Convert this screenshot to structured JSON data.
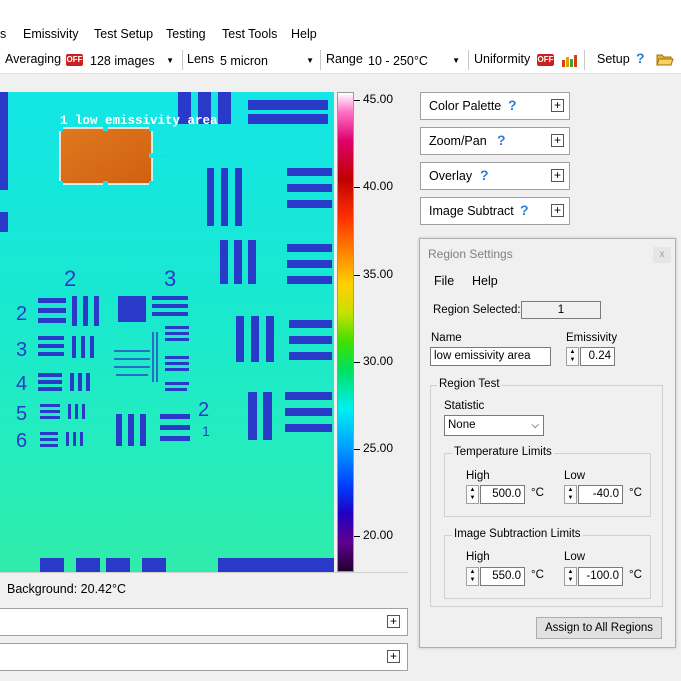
{
  "menubar": {
    "items": [
      "s",
      "Emissivity",
      "Test Setup",
      "Testing",
      "Test Tools",
      "Help"
    ]
  },
  "toolbar": {
    "averaging_label": "Averaging",
    "averaging_badge": "OFF",
    "averaging_value": "128 images",
    "lens_label": "Lens",
    "lens_value": "5 micron",
    "range_label": "Range",
    "range_value": "10 - 250°C",
    "uniformity_label": "Uniformity",
    "uniformity_badge": "OFF",
    "setup_label": "Setup",
    "help_glyph": "?"
  },
  "image": {
    "region_label": "1 low emissivity area",
    "target_numbers": [
      "2",
      "3",
      "2",
      "3",
      "4",
      "5",
      "6",
      "2",
      "1"
    ]
  },
  "colorbar": {
    "max": 45.0,
    "min": 17.5,
    "ticks": [
      "45.00",
      "40.00",
      "35.00",
      "30.00",
      "25.00",
      "20.00"
    ],
    "tick_values": [
      45,
      40,
      35,
      30,
      25,
      20
    ]
  },
  "panels": [
    {
      "label": "Color Palette",
      "q": "?"
    },
    {
      "label": "Zoom/Pan",
      "q": "?"
    },
    {
      "label": "Overlay",
      "q": "?"
    },
    {
      "label": "Image Subtract",
      "q": "?"
    }
  ],
  "region_settings": {
    "title": "Region Settings",
    "close_glyph": "x",
    "menu": [
      "File",
      "Help"
    ],
    "selected_label": "Region Selected:",
    "selected_value": "1",
    "name_label": "Name",
    "name_value": "low emissivity area",
    "emissivity_label": "Emissivity",
    "emissivity_value": "0.24",
    "region_test_label": "Region Test",
    "statistic_label": "Statistic",
    "statistic_value": "None",
    "temp_limits_label": "Temperature Limits",
    "temp_high_label": "High",
    "temp_high_value": "500.0",
    "temp_low_label": "Low",
    "temp_low_value": "-40.0",
    "unit": "°C",
    "sub_limits_label": "Image Subtraction Limits",
    "sub_high_label": "High",
    "sub_high_value": "550.0",
    "sub_low_label": "Low",
    "sub_low_value": "-100.0",
    "assign_label": "Assign to All Regions"
  },
  "status": {
    "background_label": "Background:",
    "background_value": "20.42°C"
  },
  "plus_glyph": "+"
}
